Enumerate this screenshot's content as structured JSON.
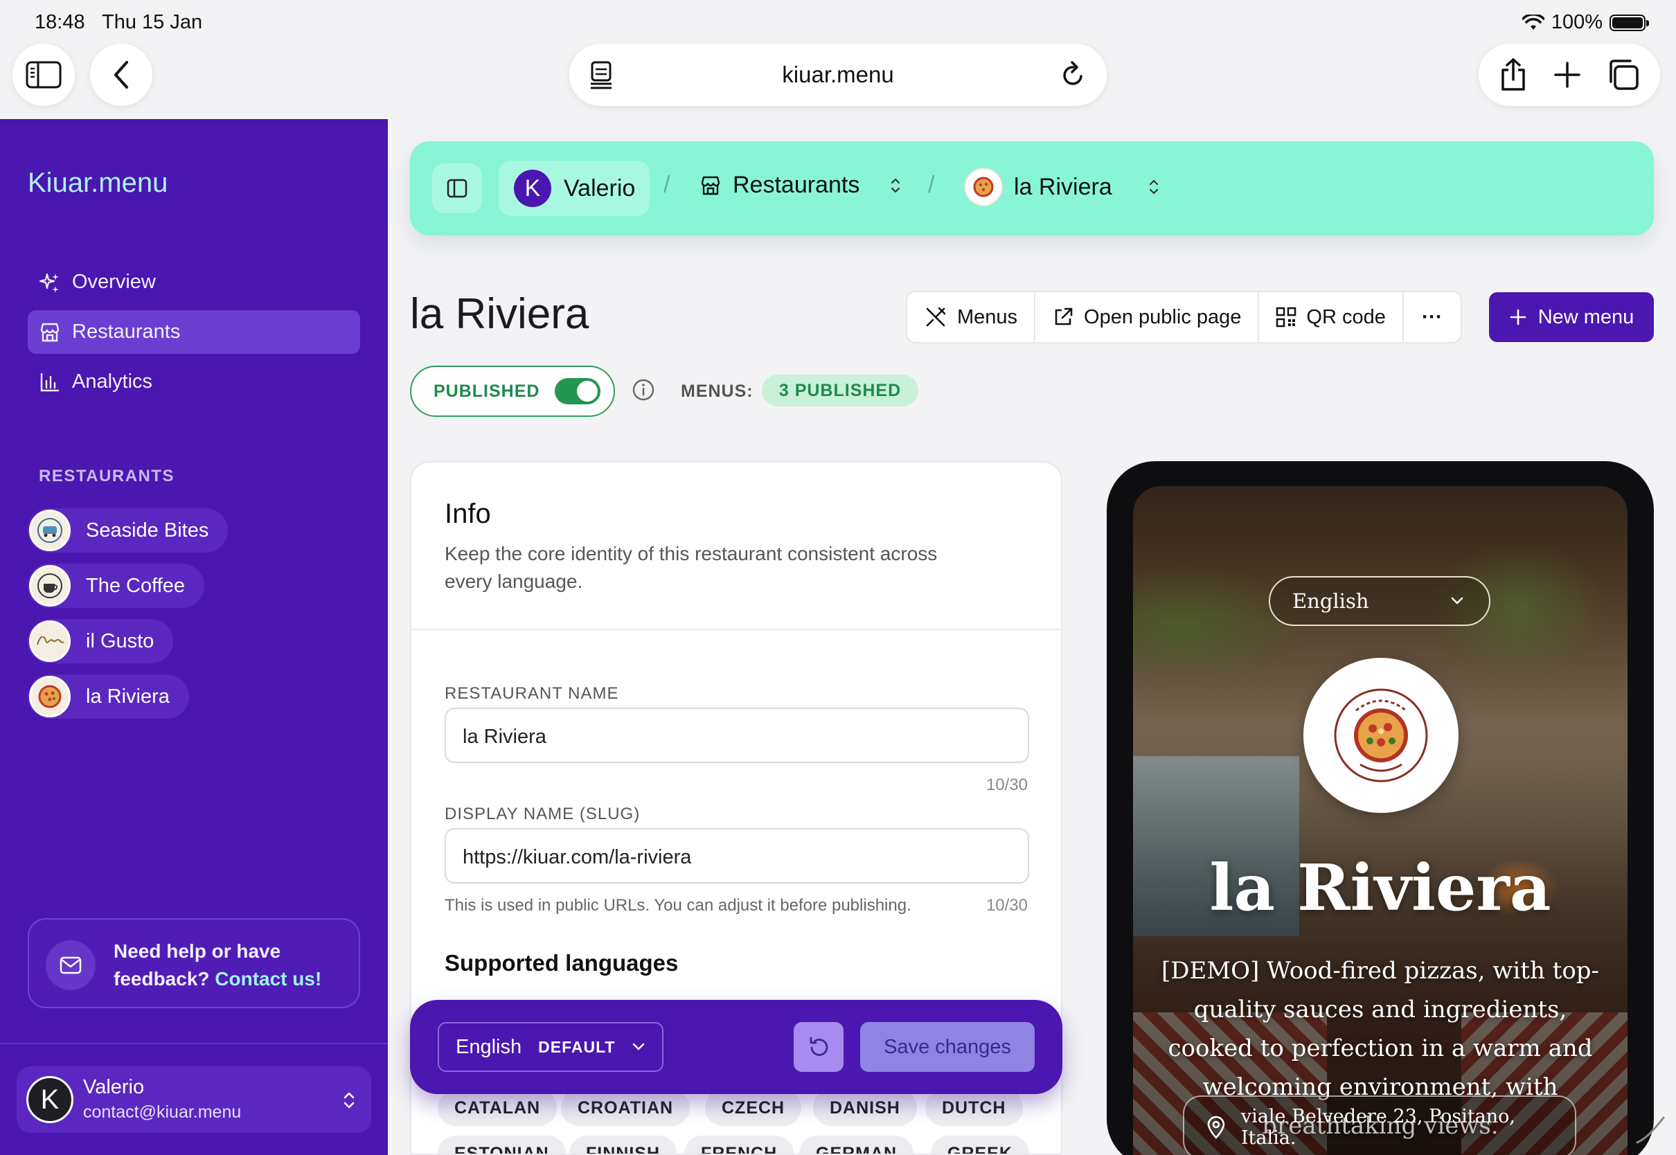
{
  "status": {
    "time": "18:48",
    "date": "Thu 15 Jan",
    "battery": "100%"
  },
  "browser": {
    "url": "kiuar.menu"
  },
  "sidebar": {
    "brand": "Kiuar.menu",
    "nav": [
      {
        "label": "Overview",
        "icon": "sparkles-icon"
      },
      {
        "label": "Restaurants",
        "icon": "store-icon",
        "active": true
      },
      {
        "label": "Analytics",
        "icon": "bar-chart-icon"
      }
    ],
    "section_label": "RESTAURANTS",
    "restaurants": [
      {
        "name": "Seaside Bites"
      },
      {
        "name": "The Coffee"
      },
      {
        "name": "il Gusto"
      },
      {
        "name": "la Riviera"
      }
    ],
    "help": {
      "text": "Need help or have feedback?",
      "link": "Contact us!"
    },
    "user": {
      "initial": "K",
      "name": "Valerio",
      "email": "contact@kiuar.menu"
    }
  },
  "breadcrumb": {
    "user_initial": "K",
    "user": "Valerio",
    "separator": "/",
    "section": "Restaurants",
    "current": "la Riviera"
  },
  "page": {
    "title": "la Riviera",
    "actions": {
      "menus": "Menus",
      "open_public": "Open public page",
      "qr": "QR code",
      "more": "···",
      "new_menu": "New menu"
    },
    "published_label": "PUBLISHED",
    "published": true,
    "menus_label": "MENUS:",
    "menus_badge": "3 PUBLISHED"
  },
  "info": {
    "title": "Info",
    "description": "Keep the core identity of this restaurant consistent across every language.",
    "name_label": "RESTAURANT NAME",
    "name_value": "la Riviera",
    "name_count": "10/30",
    "slug_label": "DISPLAY NAME (SLUG)",
    "slug_value": "https://kiuar.com/la-riviera",
    "slug_help": "This is used in public URLs. You can adjust it before publishing.",
    "slug_count": "10/30",
    "languages_title": "Supported languages",
    "languages": [
      "CATALAN",
      "CROATIAN",
      "CZECH",
      "DANISH",
      "DUTCH",
      "ESTONIAN",
      "FINNISH",
      "FRENCH",
      "GERMAN",
      "GREEK"
    ]
  },
  "savebar": {
    "language": "English",
    "default_tag": "DEFAULT",
    "save_label": "Save changes"
  },
  "preview": {
    "language": "English",
    "title": "la Riviera",
    "description": "[DEMO] Wood-fired pizzas, with top-quality sauces and ingredients, cooked to perfection in a warm and welcoming environment, with breathtaking views.",
    "address": "viale Belvedere 23, Positano, Italia."
  },
  "colors": {
    "primary": "#4a17b0",
    "accent": "#87f5d6",
    "brand_text": "#aef0f2",
    "published": "#239650"
  }
}
